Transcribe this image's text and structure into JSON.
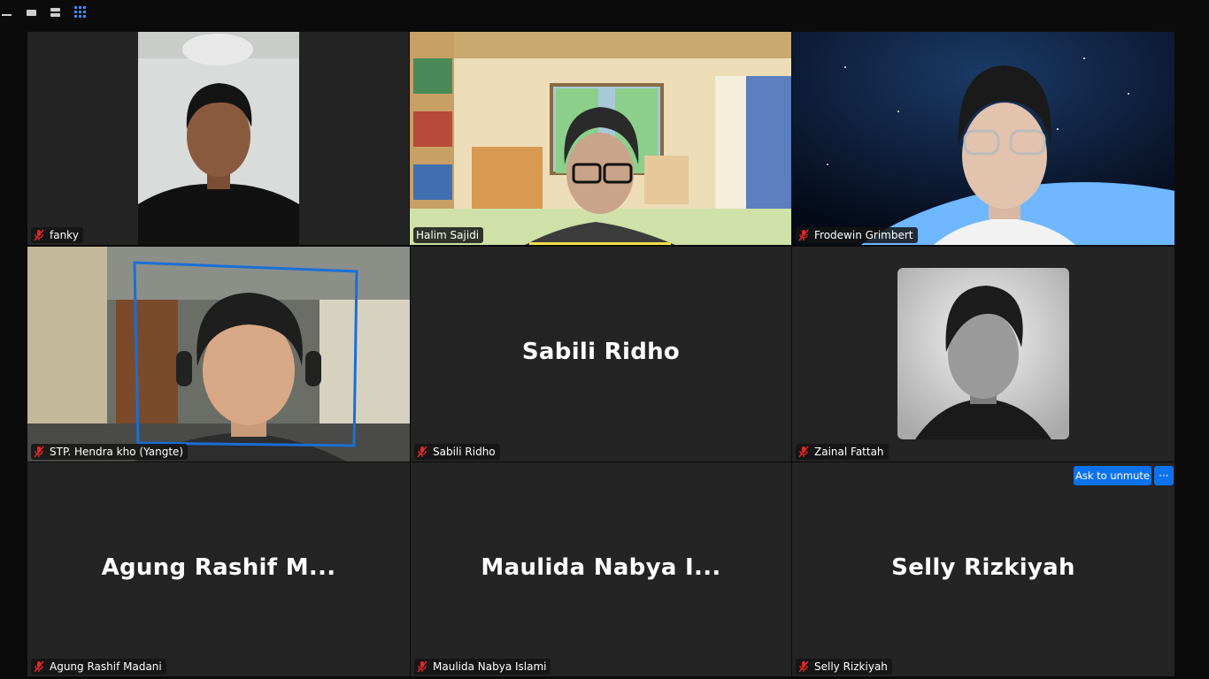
{
  "toolbar": {
    "icons": [
      "minimize-icon",
      "speaker-view-icon",
      "strip-view-icon",
      "gallery-view-icon"
    ]
  },
  "participants": [
    {
      "name": "fanky",
      "muted": true,
      "video": true
    },
    {
      "name": "Halim Sajidi",
      "muted": false,
      "video": true
    },
    {
      "name": "Frodewin Grimbert",
      "muted": true,
      "video": true
    },
    {
      "name": "STP. Hendra kho (Yangte)",
      "muted": true,
      "video": true,
      "active_speaker": true
    },
    {
      "name": "Sabili Ridho",
      "muted": true,
      "video": false,
      "display_name": "Sabili Ridho"
    },
    {
      "name": "Zainal Fattah",
      "muted": true,
      "video": false,
      "profile_photo": true
    },
    {
      "name": "Agung Rashif Madani",
      "muted": true,
      "video": false,
      "display_name": "Agung Rashif M..."
    },
    {
      "name": "Maulida Nabya Islami",
      "muted": true,
      "video": false,
      "display_name": "Maulida Nabya I..."
    },
    {
      "name": "Selly Rizkiyah",
      "muted": true,
      "video": false,
      "display_name": "Selly Rizkiyah"
    }
  ],
  "actions": {
    "ask_to_unmute": "Ask to unmute",
    "more": "···"
  },
  "colors": {
    "accent_blue": "#0e72ed",
    "active_speaker_border": "#23c552",
    "muted_icon": "#e02828",
    "tile_bg": "#242424"
  }
}
